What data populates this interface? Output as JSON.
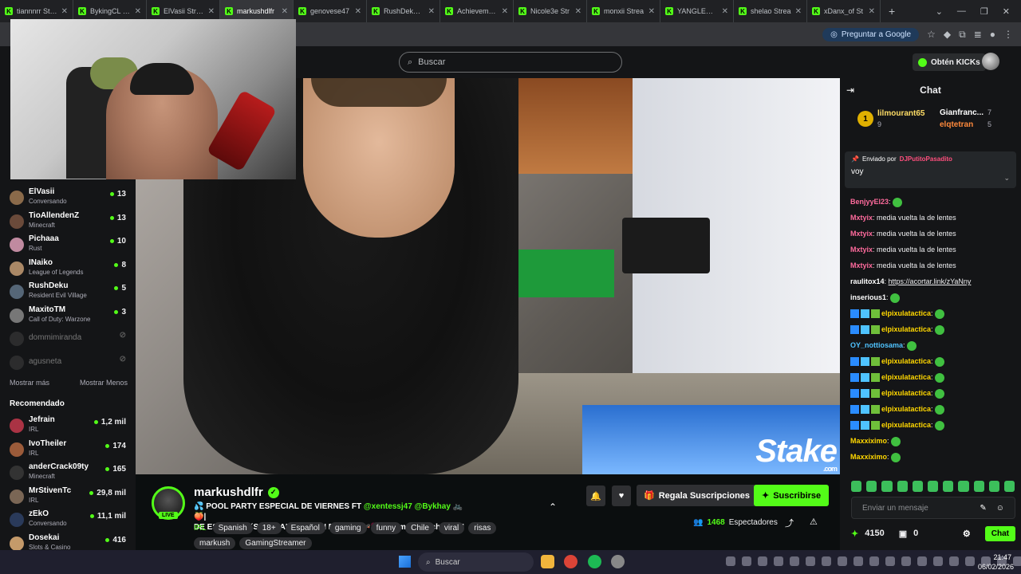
{
  "browser": {
    "tabs": [
      {
        "label": "tiannnrr Strea"
      },
      {
        "label": "BykingCL Strea"
      },
      {
        "label": "ElVasii Strea"
      },
      {
        "label": "markushdlfr"
      },
      {
        "label": "genovese47"
      },
      {
        "label": "RushDeku St"
      },
      {
        "label": "Achievement"
      },
      {
        "label": "Nicole3e Str"
      },
      {
        "label": "monxii Strea"
      },
      {
        "label": "YANGLEE Str"
      },
      {
        "label": "shelao Strea"
      },
      {
        "label": "xDanx_of St"
      }
    ],
    "active_tab_index": 3,
    "ask_google": "Preguntar a Google"
  },
  "topbar": {
    "search_placeholder": "Buscar",
    "kicks_label": "Obtén KICKs"
  },
  "sidebar": {
    "following": [
      {
        "name": "ElVasii",
        "game": "Conversando",
        "viewers": "13"
      },
      {
        "name": "TioAllendenZ",
        "game": "Minecraft",
        "viewers": "13"
      },
      {
        "name": "Pichaaa",
        "game": "Rust",
        "viewers": "10"
      },
      {
        "name": "INaiko",
        "game": "League of Legends",
        "viewers": "8"
      },
      {
        "name": "RushDeku",
        "game": "Resident Evil Village",
        "viewers": "5"
      },
      {
        "name": "MaxitoTM",
        "game": "Call of Duty: Warzone",
        "viewers": "3"
      }
    ],
    "offline": [
      {
        "name": "dommimiranda"
      },
      {
        "name": "agusneta"
      }
    ],
    "show_more": "Mostrar más",
    "show_less": "Mostrar Menos",
    "recommended_title": "Recomendado",
    "recommended": [
      {
        "name": "Jefrain",
        "game": "IRL",
        "viewers": "1,2 mil"
      },
      {
        "name": "IvoTheiler",
        "game": "IRL",
        "viewers": "174"
      },
      {
        "name": "anderCrack09ty",
        "game": "Minecraft",
        "viewers": "165"
      },
      {
        "name": "MrStivenTc",
        "game": "IRL",
        "viewers": "29,8 mil"
      },
      {
        "name": "zEkO",
        "game": "Conversando",
        "viewers": "11,1 mil"
      },
      {
        "name": "Dosekai",
        "game": "Slots & Casino",
        "viewers": "416"
      }
    ]
  },
  "player": {
    "watermark": "Stake",
    "watermark_sub": ".com"
  },
  "stream": {
    "channel": "markushdlfr",
    "live_badge": "LIVE",
    "title_line1": "💦 POOL PARTY ESPECIAL DE VIERNES FT ",
    "mention1": "@xentessj47",
    "mention2": "@Bykhay",
    "title_end1": " 🚲🍑|",
    "title_line2": "DE ESTRENO ´´SIN TOALLA´´ CON FRAN C 🛹💗los amo escuchenlo !!",
    "category": "IRL",
    "tags": [
      "Spanish",
      "18+",
      "Español",
      "gaming",
      "funny",
      "Chile",
      "viral",
      "risas",
      "markush",
      "GamingStreamer"
    ],
    "gift_label": "Regala Suscripciones",
    "subscribe_label": "Suscribirse",
    "viewers_count": "1468",
    "viewers_label": "Espectadores"
  },
  "chat": {
    "title": "Chat",
    "leaderboard": {
      "first_name": "lilmourant65",
      "first_count": "9",
      "second_name": "Gianfranc...",
      "second_count": "7",
      "third_name": "elqtetran",
      "third_count": "5"
    },
    "pinned": {
      "label": "Enviado por",
      "user": "DJPutitoPasadito",
      "message": "voy"
    },
    "messages": [
      {
        "user": "BenjyyEl23",
        "color": "#ff6b9d",
        "text": ""
      },
      {
        "user": "Mxtyix",
        "color": "#ff6b9d",
        "text": "media vuelta la de lentes"
      },
      {
        "user": "Mxtyix",
        "color": "#ff6b9d",
        "text": "media vuelta la de lentes"
      },
      {
        "user": "Mxtyix",
        "color": "#ff6b9d",
        "text": "media vuelta la de lentes"
      },
      {
        "user": "Mxtyix",
        "color": "#ff6b9d",
        "text": "media vuelta la de lentes"
      },
      {
        "user": "raulitox14",
        "color": "#ffffff",
        "text": "https://acortar.link/zYaNny"
      },
      {
        "user": "inserious1",
        "color": "#ffffff",
        "text": ""
      },
      {
        "user": "elpixulatactica",
        "color": "#ffd700",
        "text": ""
      },
      {
        "user": "elpixulatactica",
        "color": "#ffd700",
        "text": ""
      },
      {
        "user": "OY_nottiosama",
        "color": "#4fc3ff",
        "text": ""
      },
      {
        "user": "elpixulatactica",
        "color": "#ffd700",
        "text": ""
      },
      {
        "user": "elpixulatactica",
        "color": "#ffd700",
        "text": ""
      },
      {
        "user": "elpixulatactica",
        "color": "#ffd700",
        "text": ""
      },
      {
        "user": "elpixulatactica",
        "color": "#ffd700",
        "text": ""
      },
      {
        "user": "elpixulatactica",
        "color": "#ffd700",
        "text": ""
      },
      {
        "user": "Maxxiximo",
        "color": "#ffd700",
        "text": ""
      },
      {
        "user": "Maxxiximo",
        "color": "#ffd700",
        "text": ""
      }
    ],
    "input_placeholder": "Enviar un mensaje",
    "kicks_balance": "4150",
    "sub_count": "0",
    "send_label": "Chat"
  },
  "taskbar": {
    "search_placeholder": "Buscar",
    "time": "21:47",
    "date": "06/02/2026"
  }
}
